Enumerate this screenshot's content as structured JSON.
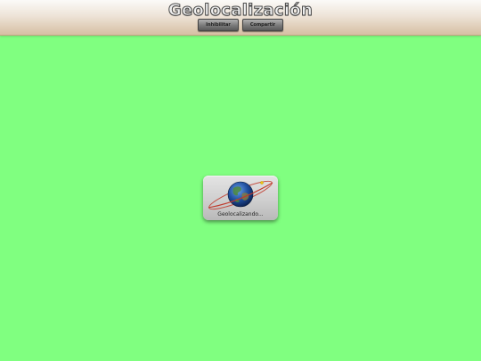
{
  "header": {
    "title": "Geolocalización",
    "buttons": [
      {
        "label": "Inhibilitar"
      },
      {
        "label": "Compartir"
      }
    ]
  },
  "main": {
    "background_color": "#80ff80"
  },
  "loader": {
    "icon": "globe-orbit-icon",
    "label": "Geolocalizando..."
  }
}
